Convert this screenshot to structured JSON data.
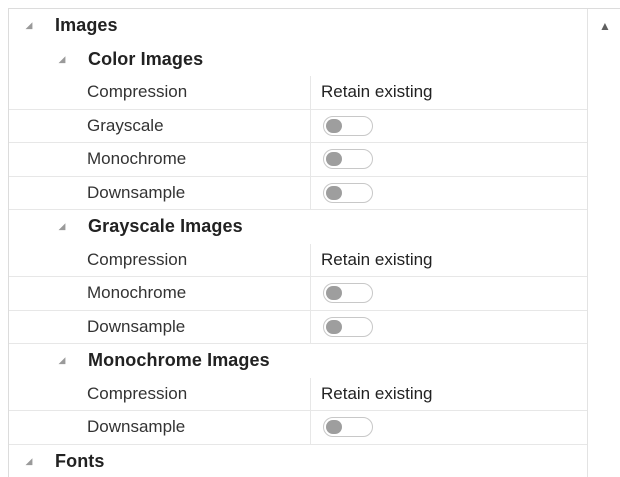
{
  "property_grid": {
    "categories": [
      {
        "title": "Images",
        "subcategories": [
          {
            "title": "Color Images",
            "properties": [
              {
                "name": "Compression",
                "value": "Retain existing"
              },
              {
                "name": "Grayscale",
                "toggle": false
              },
              {
                "name": "Monochrome",
                "toggle": false
              },
              {
                "name": "Downsample",
                "toggle": false
              }
            ]
          },
          {
            "title": "Grayscale Images",
            "properties": [
              {
                "name": "Compression",
                "value": "Retain existing"
              },
              {
                "name": "Monochrome",
                "toggle": false
              },
              {
                "name": "Downsample",
                "toggle": false
              }
            ]
          },
          {
            "title": "Monochrome Images",
            "properties": [
              {
                "name": "Compression",
                "value": "Retain existing"
              },
              {
                "name": "Downsample",
                "toggle": false
              }
            ]
          }
        ]
      },
      {
        "title": "Fonts",
        "subcategories": []
      }
    ],
    "expand_glyph": "◢",
    "scroll_up_glyph": "▲"
  },
  "colors": {
    "toggle_off_knob": "#9e9e9e",
    "grid_line": "#e7e7e7"
  }
}
